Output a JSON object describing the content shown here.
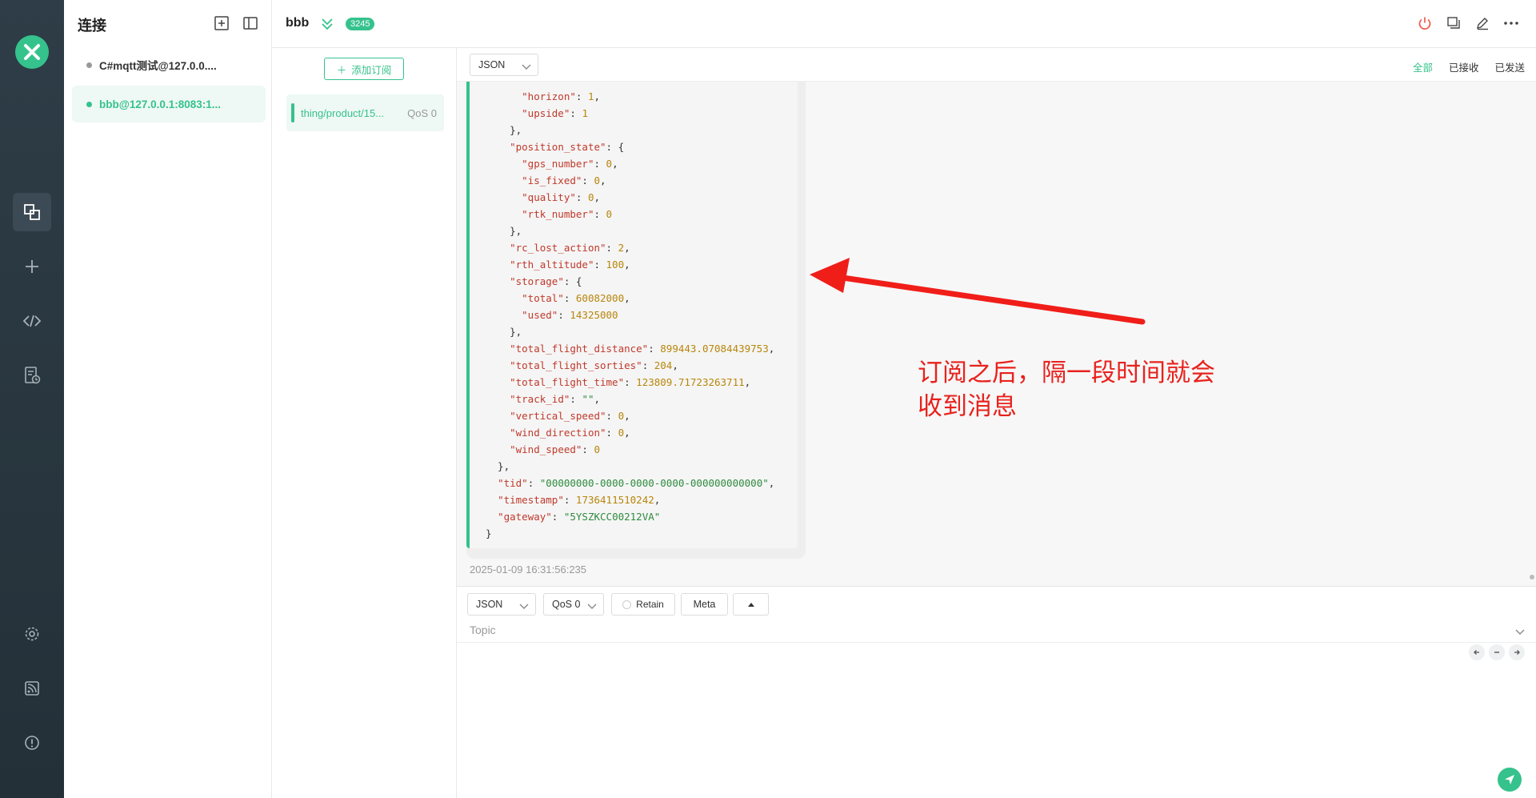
{
  "connections": {
    "title": "连接",
    "items": [
      {
        "label": "C#mqtt测试@127.0.0....",
        "status_color": "#999999"
      },
      {
        "label": "bbb@127.0.0.1:8083:1...",
        "status_color": "#35c28d"
      }
    ]
  },
  "header": {
    "title": "bbb",
    "count": "3245"
  },
  "subscriptions": {
    "add_label": "添加订阅",
    "items": [
      {
        "topic": "thing/product/15...",
        "qos": "QoS 0"
      }
    ]
  },
  "message_bar": {
    "format": "JSON",
    "filters": [
      "全部",
      "已接收",
      "已发送"
    ]
  },
  "message": {
    "timestamp": "2025-01-09 16:31:56:235"
  },
  "annotation": {
    "text": "订阅之后，隔一段时间就会\n收到消息"
  },
  "composer": {
    "format": "JSON",
    "qos": "QoS 0",
    "retain_label": "Retain",
    "meta_label": "Meta",
    "topic_placeholder": "Topic"
  },
  "colors": {
    "accent": "#35c28d",
    "nav_bg": "#2e3d47",
    "annotation": "#e8221d"
  }
}
